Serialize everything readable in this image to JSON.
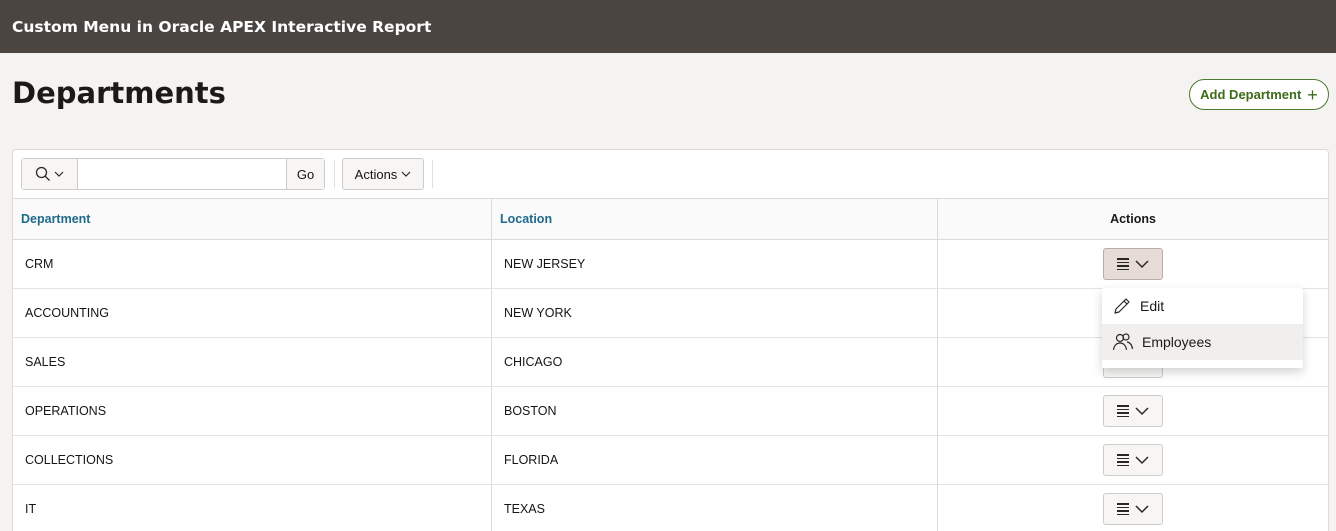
{
  "app": {
    "title": "Custom Menu in Oracle APEX Interactive Report"
  },
  "page": {
    "title": "Departments",
    "add_button_label": "Add Department"
  },
  "toolbar": {
    "search_placeholder": "",
    "go_label": "Go",
    "actions_label": "Actions"
  },
  "grid": {
    "headers": {
      "department": "Department",
      "location": "Location",
      "actions": "Actions"
    },
    "rows": [
      {
        "department": "CRM",
        "location": "NEW JERSEY"
      },
      {
        "department": "ACCOUNTING",
        "location": "NEW YORK"
      },
      {
        "department": "SALES",
        "location": "CHICAGO"
      },
      {
        "department": "OPERATIONS",
        "location": "BOSTON"
      },
      {
        "department": "COLLECTIONS",
        "location": "FLORIDA"
      },
      {
        "department": "IT",
        "location": "TEXAS"
      }
    ]
  },
  "row_menu": {
    "items": [
      {
        "label": "Edit",
        "icon": "pencil-icon"
      },
      {
        "label": "Employees",
        "icon": "users-icon"
      }
    ]
  },
  "colors": {
    "header_bg": "#4a4540",
    "accent_green": "#3c6b1a",
    "link_blue": "#1e6a8a"
  }
}
